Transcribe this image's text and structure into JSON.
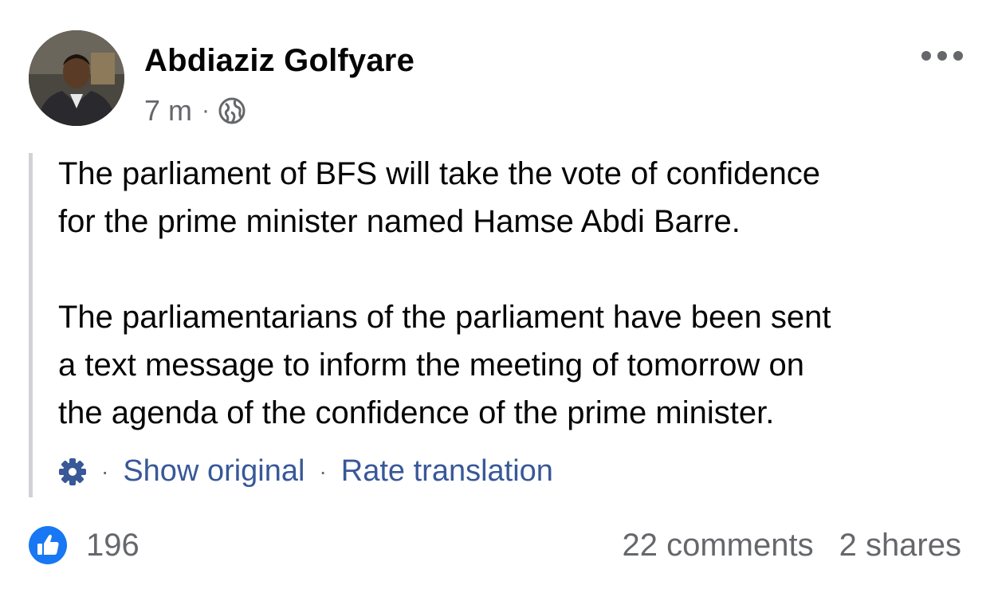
{
  "post": {
    "author": "Abdiaziz Golfyare",
    "time": "7 m",
    "meta_separator": "·",
    "privacy_icon": "globe-icon",
    "more_icon": "more-horizontal-icon",
    "avatar": "profile-photo",
    "paragraphs": [
      "The parliament of BFS will take the vote of confidence\nfor the prime minister named Hamse Abdi Barre.",
      "The parliamentarians of the parliament have been sent\na text message to inform the meeting of tomorrow on\nthe agenda of the confidence of the prime minister."
    ]
  },
  "translation": {
    "settings_icon": "gear-icon",
    "separator": "·",
    "show_original": "Show original",
    "rate_translation": "Rate translation"
  },
  "footer": {
    "like_icon": "thumbs-up-icon",
    "like_count": "196",
    "comments": "22 comments",
    "shares": "2 shares"
  },
  "colors": {
    "link": "#385898",
    "secondary_text": "#65676b",
    "like_blue": "#1877f2",
    "quote_bar": "#d0d2d6"
  }
}
